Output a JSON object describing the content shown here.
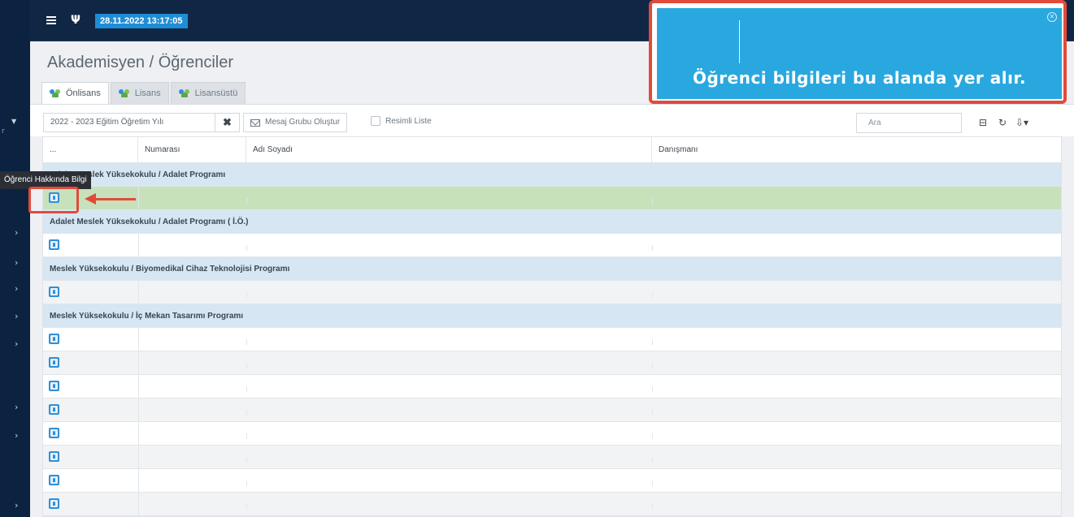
{
  "topbar": {
    "datetime": "28.11.2022 13:17:05"
  },
  "page": {
    "title": "Akademisyen / Öğrenciler"
  },
  "tabs": [
    {
      "label": "Önlisans",
      "active": true
    },
    {
      "label": "Lisans",
      "active": false
    },
    {
      "label": "Lisansüstü",
      "active": false
    }
  ],
  "toolbar": {
    "year_select": "2022 - 2023 Eğitim Öğretim Yılı",
    "clear_label": "✖",
    "message_group_label": "Mesaj Grubu Oluştur",
    "photo_list_label": "Resimli Liste",
    "search_placeholder": "Ara"
  },
  "table": {
    "headers": [
      "...",
      "Numarası",
      "Adı Soyadı",
      "Danışmanı"
    ],
    "groups": [
      {
        "label": "Adalet Meslek Yüksekokulu / Adalet Programı",
        "rows": 1
      },
      {
        "label": "Adalet Meslek Yüksekokulu / Adalet Programı ( İ.Ö.)",
        "rows": 1
      },
      {
        "label": "Meslek Yüksekokulu / Biyomedikal Cihaz Teknolojisi Programı",
        "rows": 1
      },
      {
        "label": "Meslek Yüksekokulu / İç Mekan Tasarımı Programı",
        "rows": 8
      }
    ]
  },
  "tooltip": {
    "text": "Öğrenci Hakkında Bilgi"
  },
  "callout": {
    "text": "Öğrenci bilgileri bu alanda yer alır."
  },
  "colors": {
    "sidebar": "#0b2341",
    "topbar": "#0f2744",
    "datetime_badge": "#1f8dd6",
    "group_row": "#d6e6f2",
    "selected_row": "#c7e1bb",
    "callout_bg": "#29a8df",
    "annotation_red": "#e24a3b"
  }
}
